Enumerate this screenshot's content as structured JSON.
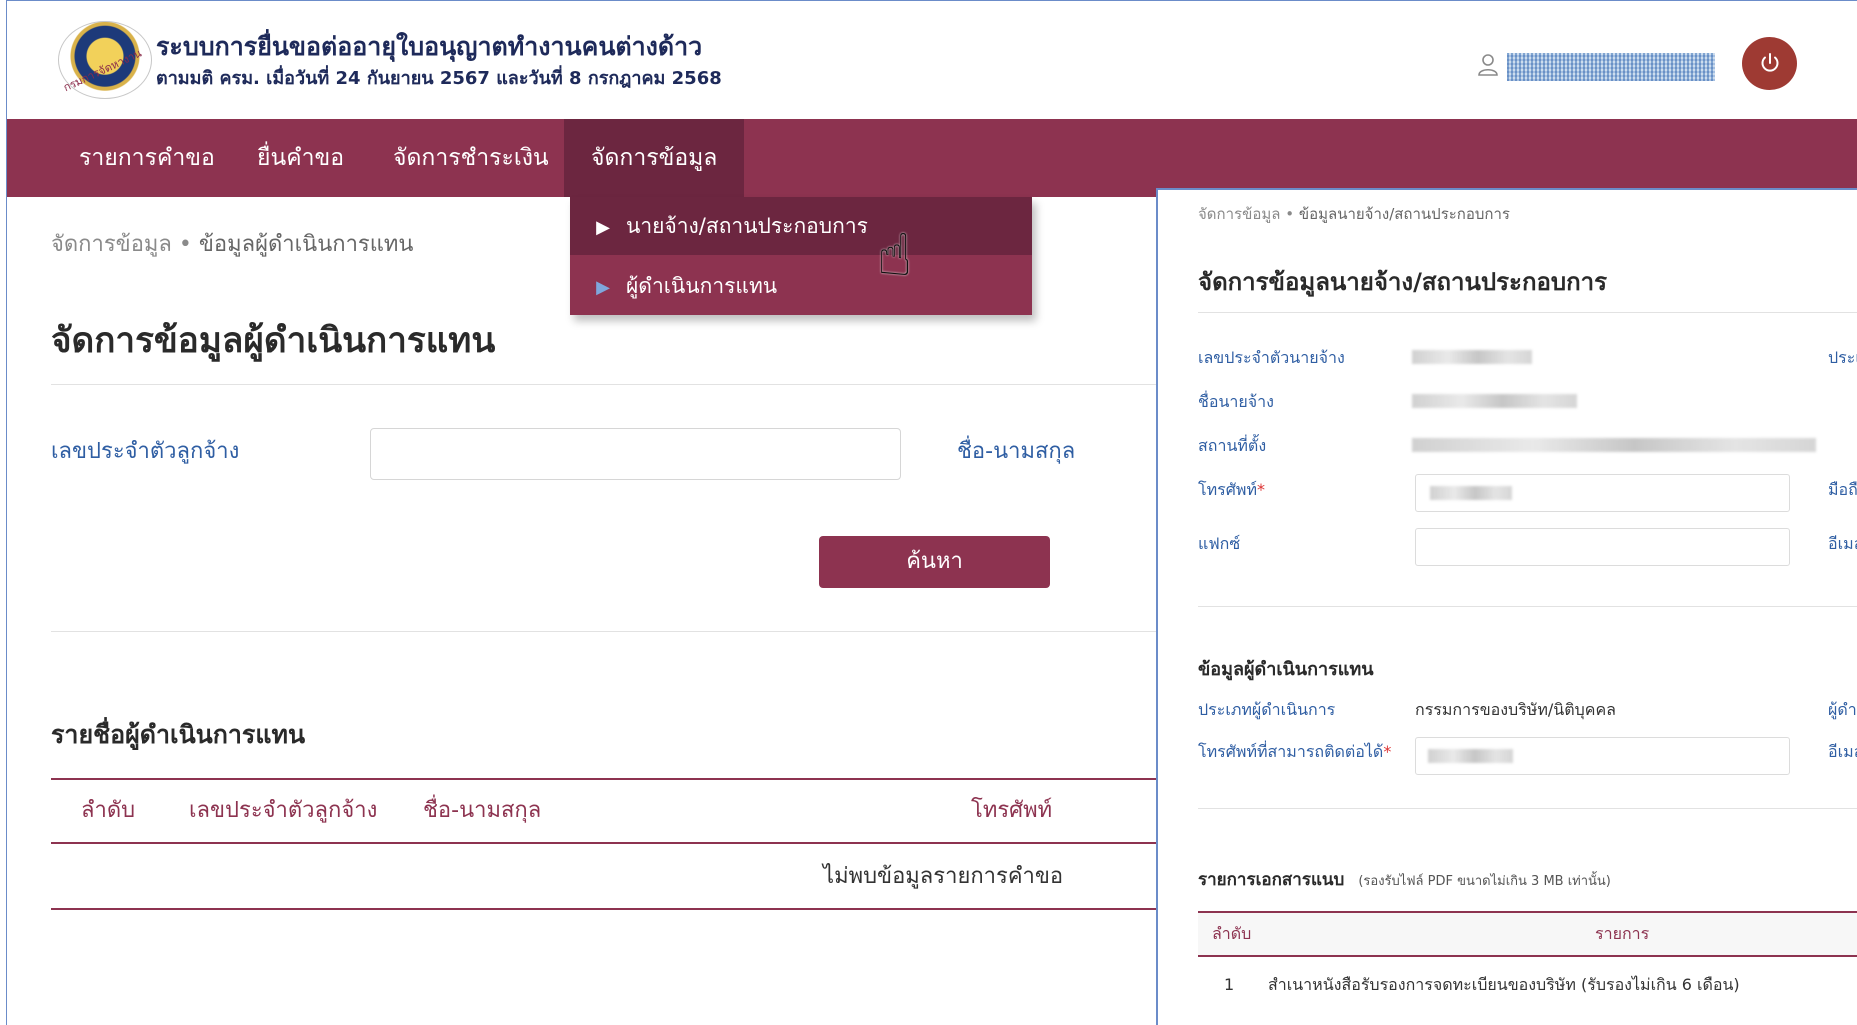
{
  "header": {
    "title": "ระบบการยื่นขอต่ออายุใบอนุญาตทำงานคนต่างด้าว",
    "subtitle": "ตามมติ ครม. เมื่อวันที่ 24 กันยายน 2567 และวันที่ 8 กรกฎาคม 2568",
    "logo_text": "กรมการจัดหางาน",
    "user_icon": "user-icon",
    "power_icon": "power-icon"
  },
  "nav": {
    "items": [
      {
        "label": "รายการคำขอ"
      },
      {
        "label": "ยื่นคำขอ"
      },
      {
        "label": "จัดการชำระเงิน"
      },
      {
        "label": "จัดการข้อมูล"
      }
    ],
    "dropdown": [
      {
        "label": "นายจ้าง/สถานประกอบการ"
      },
      {
        "label": "ผู้ดำเนินการแทน"
      }
    ]
  },
  "main": {
    "breadcrumb_root": "จัดการข้อมูล",
    "breadcrumb_sep": "•",
    "breadcrumb_current": "ข้อมูลผู้ดำเนินการแทน",
    "page_title": "จัดการข้อมูลผู้ดำเนินการแทน",
    "employee_id_label": "เลขประจำตัวลูกจ้าง",
    "employee_id_value": "",
    "name_label": "ชื่อ-นามสกุล",
    "search_button": "ค้นหา",
    "list_title": "รายชื่อผู้ดำเนินการแทน",
    "table_headers": [
      "ลำดับ",
      "เลขประจำตัวลูกจ้าง",
      "ชื่อ-นามสกุล",
      "โทรศัพท์"
    ],
    "empty_message": "ไม่พบข้อมูลรายการคำขอ"
  },
  "panel": {
    "breadcrumb_root": "จัดการข้อมูล",
    "breadcrumb_sep": "•",
    "breadcrumb_current": "ข้อมูลนายจ้าง/สถานประกอบการ",
    "title": "จัดการข้อมูลนายจ้าง/สถานประกอบการ",
    "employer_id_label": "เลขประจำตัวนายจ้าง",
    "employer_type_label_partial": "ประเ",
    "employer_name_label": "ชื่อนายจ้าง",
    "address_label": "สถานที่ตั้ง",
    "phone_label": "โทรศัพท์",
    "mobile_label_partial": "มือถื",
    "fax_label": "แฟกซ์",
    "email_label_partial": "อีเมล",
    "required_mark": "*",
    "rep_section_title": "ข้อมูลผู้ดำเนินการแทน",
    "rep_type_label": "ประเภทผู้ดำเนินการ",
    "rep_type_value": "กรรมการของบริษัท/นิติบุคคล",
    "rep_name_label_partial": "ผู้ดำเ",
    "rep_phone_label": "โทรศัพท์ที่สามารถติดต่อได้",
    "rep_email_label_partial": "อีเมล",
    "docs_title": "รายการเอกสารแนบ",
    "docs_note": "(รองรับไฟล์ PDF ขนาดไม่เกิน 3 MB เท่านั้น)",
    "docs_headers": [
      "ลำดับ",
      "รายการ"
    ],
    "docs_rows": [
      {
        "no": "1",
        "item": "สำเนาหนังสือรับรองการจดทะเบียนของบริษัท (รับรองไม่เกิน 6 เดือน)"
      }
    ]
  },
  "colors": {
    "brand": "#8d3350",
    "brand_dark": "#6c2640",
    "power": "#9e3a33",
    "label_blue": "#2f5ea3"
  }
}
